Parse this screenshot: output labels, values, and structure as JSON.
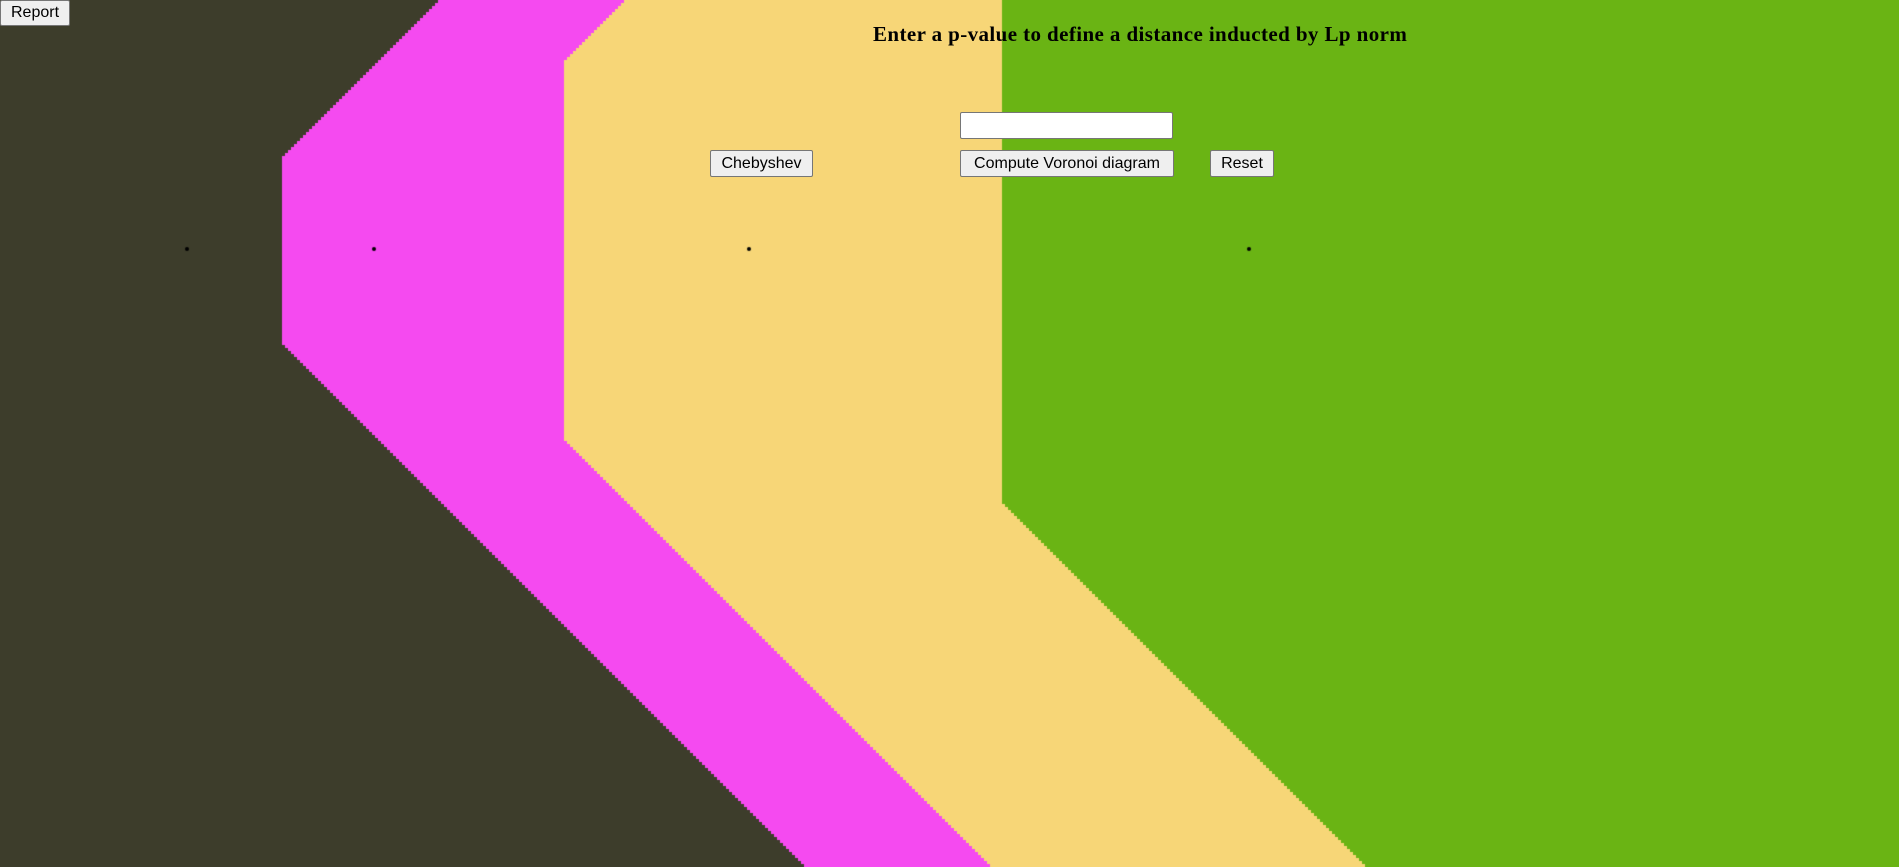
{
  "page": {
    "title": "Enter a p-value to define a distance inducted by Lp norm"
  },
  "controls": {
    "report_label": "Report",
    "chebyshev_label": "Chebyshev",
    "compute_label": "Compute Voronoi diagram",
    "reset_label": "Reset",
    "p_input_value": ""
  },
  "diagram": {
    "metric": "Chebyshev",
    "colors": {
      "region_1": "#3d3d2b",
      "region_2": "#f54af0",
      "region_3": "#f7d677",
      "region_4": "#6ab414",
      "site_point": "#000000"
    },
    "site_count": 4
  }
}
